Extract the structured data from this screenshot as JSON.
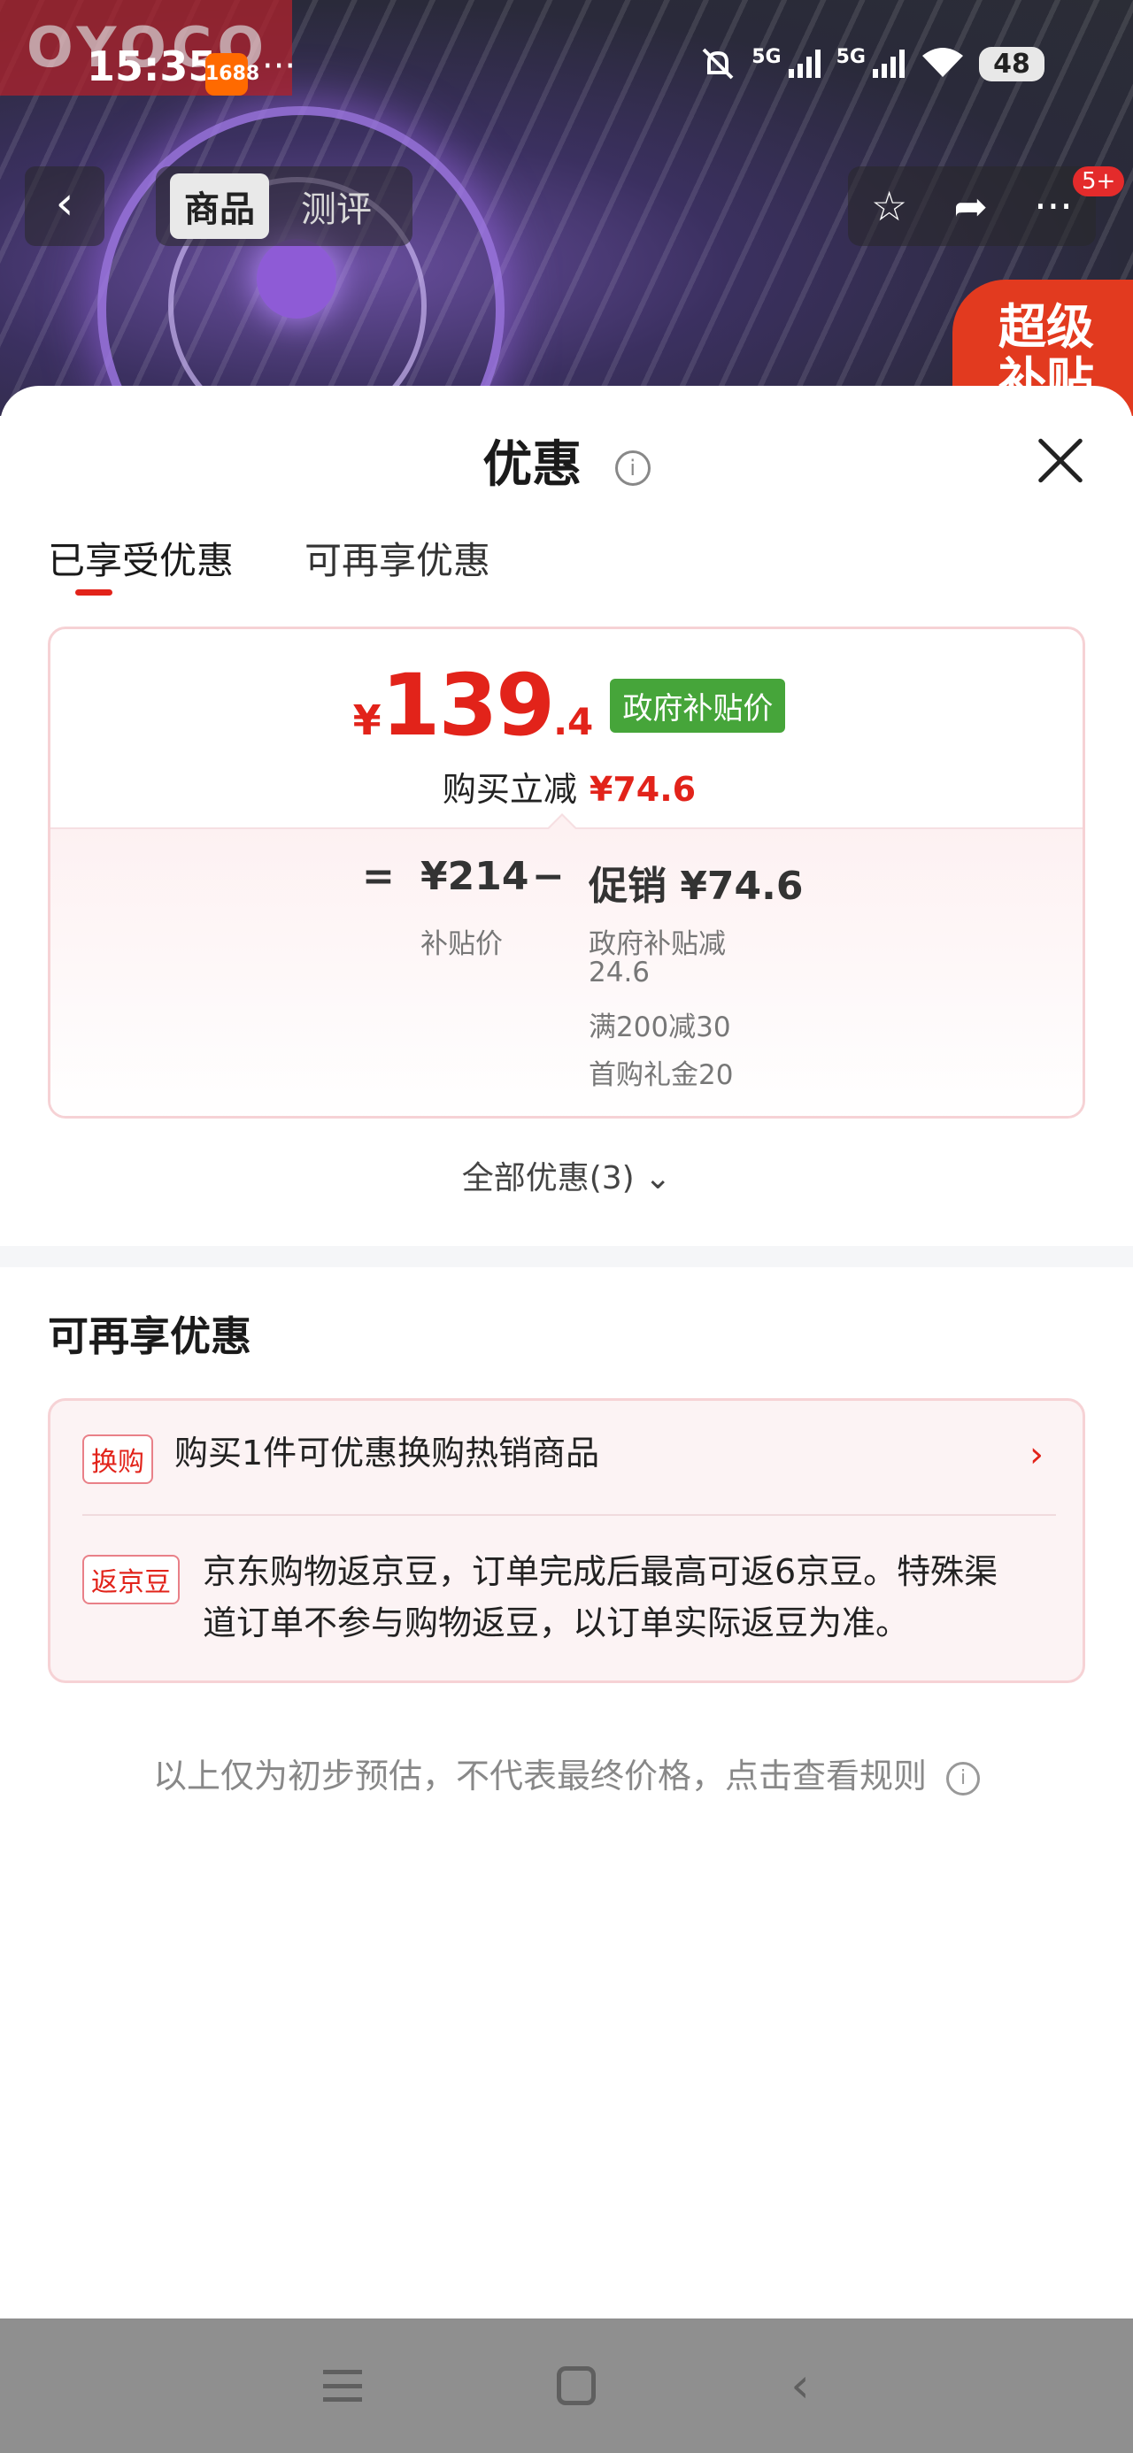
{
  "background": {
    "brand_tag": "OYOCO",
    "status_bar": {
      "time": "15:35",
      "app_badge": "1688",
      "more": "···",
      "network": "5G",
      "network2": "5G",
      "battery": "48"
    },
    "nav_tabs": [
      "商品",
      "测评"
    ],
    "active_nav_tab": 0,
    "badge": "5+",
    "promo_corner": [
      "超级",
      "补贴"
    ]
  },
  "sheet": {
    "title": "优惠",
    "tabs": [
      "已享受优惠",
      "可再享优惠"
    ],
    "active_tab": 0
  },
  "price_card": {
    "currency": "¥",
    "price_integer": "139",
    "price_decimal": ".4",
    "badge": "政府补贴价",
    "instant_label": "购买立减",
    "instant_amount": "¥74.6",
    "equals": "=",
    "base_price": "¥214",
    "base_label": "补贴价",
    "minus": "−",
    "promo_label": "促销 ¥74.6",
    "promo_items": [
      "政府补贴减",
      "24.6",
      "满200减30",
      "首购礼金20"
    ]
  },
  "all_offers_link": "全部优惠(3)",
  "more_section": {
    "title": "可再享优惠",
    "rows": [
      {
        "tag": "换购",
        "text": "购买1件可优惠换购热销商品"
      },
      {
        "tag": "返京豆",
        "text_line1": "京东购物返京豆，订单完成后最高可返6京豆。特殊渠",
        "text_line2": "道订单不参与购物返豆，以订单实际返豆为准。"
      }
    ]
  },
  "footnote": "以上仅为初步预估，不代表最终价格，点击查看规则",
  "colors": {
    "accent": "#e2231a",
    "gov_green": "#46a53a",
    "card_border": "#f6d2d5"
  }
}
